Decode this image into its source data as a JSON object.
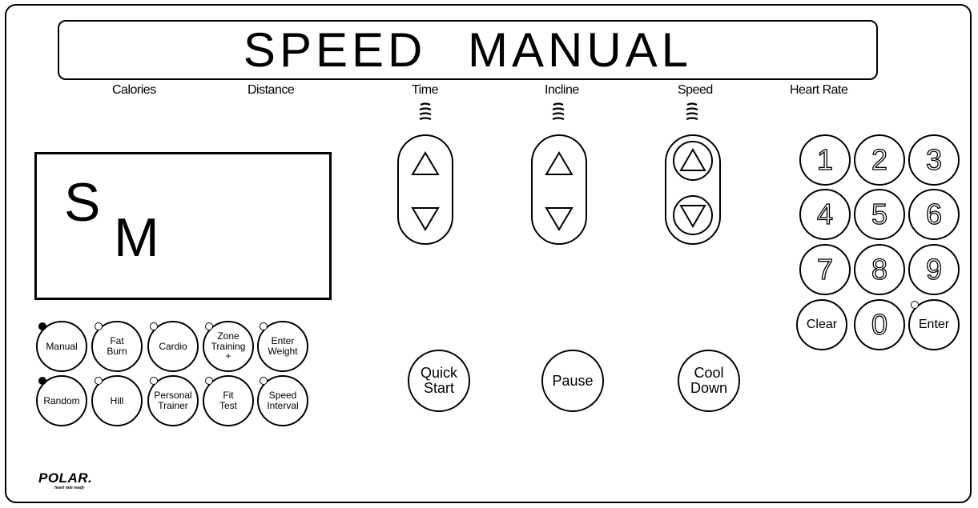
{
  "banner": {
    "text": "SPEED MANUAL"
  },
  "metrics": [
    "Calories",
    "Distance",
    "Time",
    "Incline",
    "Speed",
    "Heart Rate"
  ],
  "display": {
    "top_letter": "S",
    "bottom_letter": "M"
  },
  "programs": {
    "row1": [
      "Manual",
      "Fat\nBurn",
      "Cardio",
      "Zone\nTraining\n+",
      "Enter\nWeight"
    ],
    "row2": [
      "Random",
      "Hill",
      "Personal\nTrainer",
      "Fit\nTest",
      "Speed\nInterval"
    ],
    "lit": [
      "Manual",
      "Random"
    ]
  },
  "actions": {
    "quick_start": "Quick\nStart",
    "pause": "Pause",
    "cool_down": "Cool\nDown"
  },
  "keypad": [
    "1",
    "2",
    "3",
    "4",
    "5",
    "6",
    "7",
    "8",
    "9",
    "Clear",
    "0",
    "Enter"
  ],
  "logo": {
    "brand": "POLAR.",
    "tagline": "heart rate ready"
  },
  "icons": {
    "time_indicator": "signal-bars-icon",
    "incline_indicator": "signal-bars-icon",
    "speed_indicator": "signal-bars-icon",
    "up": "triangle-up-icon",
    "down": "triangle-down-icon"
  }
}
